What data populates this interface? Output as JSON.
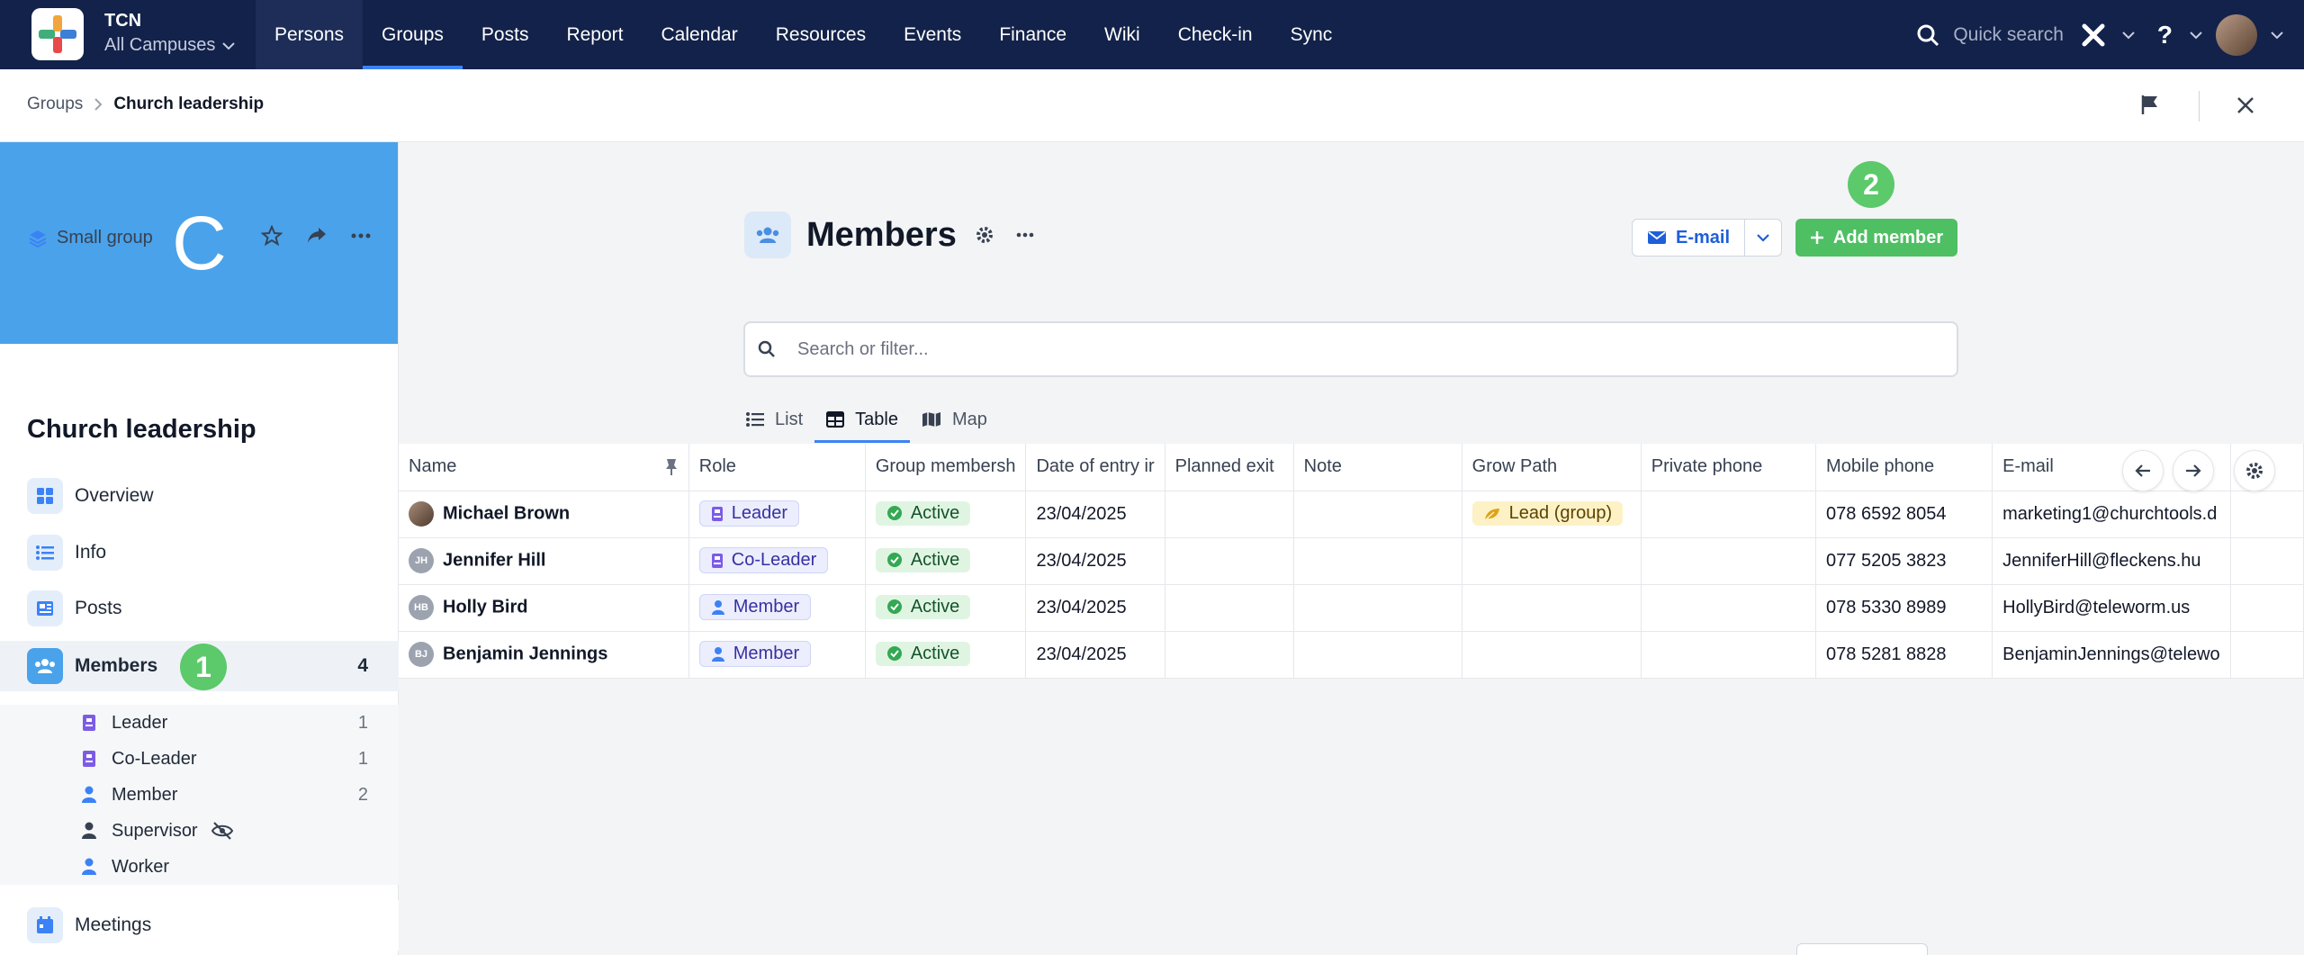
{
  "app": {
    "name": "TCN",
    "campus": "All Campuses",
    "nav": [
      "Persons",
      "Groups",
      "Posts",
      "Report",
      "Calendar",
      "Resources",
      "Events",
      "Finance",
      "Wiki",
      "Check-in",
      "Sync"
    ],
    "active_nav": "Groups",
    "quick_search": "Quick search"
  },
  "breadcrumb": {
    "parent": "Groups",
    "current": "Church leadership"
  },
  "group": {
    "initial": "C",
    "type": "Small group",
    "name": "Church leadership",
    "menu": [
      {
        "label": "Overview",
        "icon": "grid-icon"
      },
      {
        "label": "Info",
        "icon": "list-icon"
      },
      {
        "label": "Posts",
        "icon": "newspaper-icon"
      },
      {
        "label": "Members",
        "icon": "people-icon",
        "count": "4"
      },
      {
        "label": "Meetings",
        "icon": "calendar-icon"
      }
    ],
    "roles": [
      {
        "label": "Leader",
        "count": "1",
        "icon": "badge-icon"
      },
      {
        "label": "Co-Leader",
        "count": "1",
        "icon": "badge-icon"
      },
      {
        "label": "Member",
        "count": "2",
        "icon": "person-icon"
      },
      {
        "label": "Supervisor",
        "count": "",
        "icon": "person-icon"
      },
      {
        "label": "Worker",
        "count": "",
        "icon": "person-icon"
      }
    ]
  },
  "callouts": {
    "one": "1",
    "two": "2"
  },
  "main": {
    "title": "Members",
    "email_button": "E-mail",
    "add_button": "Add member",
    "search_placeholder": "Search or filter...",
    "views": [
      "List",
      "Table",
      "Map"
    ],
    "active_view": "Table"
  },
  "table": {
    "columns": [
      "Name",
      "Role",
      "Group membersh",
      "Date of entry ir",
      "Planned exit",
      "Note",
      "Grow Path",
      "Private phone",
      "Mobile phone",
      "E-mail"
    ],
    "rows": [
      {
        "initials": "",
        "name": "Michael Brown",
        "role": "Leader",
        "status": "Active",
        "entry": "23/04/2025",
        "exit": "",
        "note": "",
        "grow": "Lead (group)",
        "private": "",
        "mobile": "078 6592 8054",
        "email": "marketing1@churchtools.d"
      },
      {
        "initials": "JH",
        "name": "Jennifer Hill",
        "role": "Co-Leader",
        "status": "Active",
        "entry": "23/04/2025",
        "exit": "",
        "note": "",
        "grow": "",
        "private": "",
        "mobile": "077 5205 3823",
        "email": "JenniferHill@fleckens.hu"
      },
      {
        "initials": "HB",
        "name": "Holly Bird",
        "role": "Member",
        "status": "Active",
        "entry": "23/04/2025",
        "exit": "",
        "note": "",
        "grow": "",
        "private": "",
        "mobile": "078 5330 8989",
        "email": "HollyBird@teleworm.us"
      },
      {
        "initials": "BJ",
        "name": "Benjamin Jennings",
        "role": "Member",
        "status": "Active",
        "entry": "23/04/2025",
        "exit": "",
        "note": "",
        "grow": "",
        "private": "",
        "mobile": "078 5281 8828",
        "email": "BenjaminJennings@telewo"
      }
    ]
  },
  "colors": {
    "topbar": "#13224a",
    "accent": "#3b82f6",
    "banner": "#4aa2ea",
    "success": "#4fbf63"
  }
}
